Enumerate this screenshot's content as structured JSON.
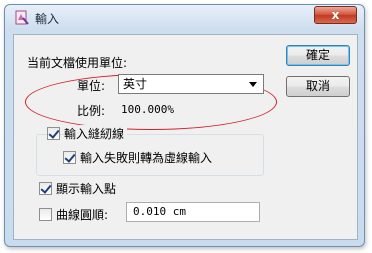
{
  "window": {
    "title": "輸入",
    "close_label": "x"
  },
  "units": {
    "section_label": "当前文檔使用單位:",
    "unit_label": "單位:",
    "unit_value": "英寸",
    "scale_label": "比例:",
    "scale_value": "100.000%"
  },
  "buttons": {
    "ok": "確定",
    "cancel": "取消"
  },
  "input_wire": {
    "label": "輸入縫紉線",
    "checked": true,
    "convert_label": "輸入失敗則轉為虛線輸入",
    "convert_checked": true
  },
  "show_points": {
    "label": "顯示輸入點",
    "checked": true
  },
  "curve_smooth": {
    "label": "曲線圓順:",
    "checked": false,
    "value": "0.010 cm"
  },
  "colors": {
    "highlight_oval": "#d4202a",
    "close_button": "#c03a22"
  }
}
